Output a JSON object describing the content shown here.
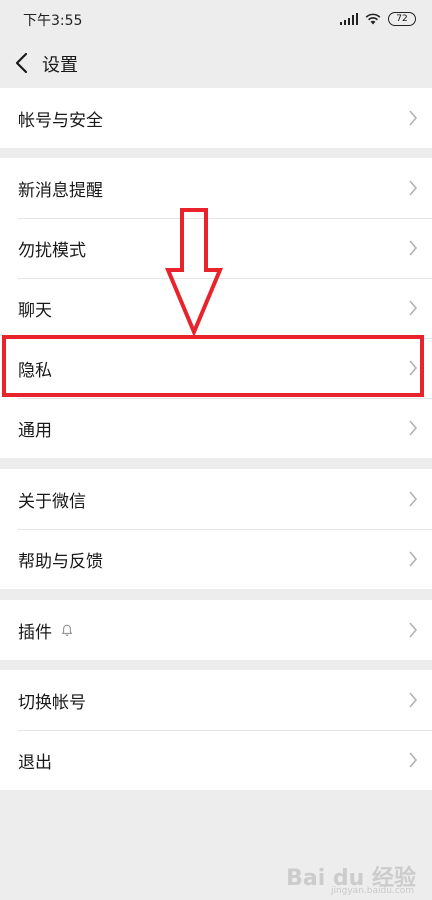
{
  "status_bar": {
    "time": "下午3:55",
    "battery": "72"
  },
  "nav": {
    "title": "设置"
  },
  "groups": [
    {
      "items": [
        {
          "label": "帐号与安全"
        }
      ]
    },
    {
      "items": [
        {
          "label": "新消息提醒"
        },
        {
          "label": "勿扰模式"
        },
        {
          "label": "聊天"
        },
        {
          "label": "隐私"
        },
        {
          "label": "通用"
        }
      ]
    },
    {
      "items": [
        {
          "label": "关于微信"
        },
        {
          "label": "帮助与反馈"
        }
      ]
    },
    {
      "items": [
        {
          "label": "插件"
        }
      ]
    },
    {
      "items": [
        {
          "label": "切换帐号"
        },
        {
          "label": "退出"
        }
      ]
    }
  ],
  "annotation": {
    "highlight_color": "#e8232b",
    "highlighted_item": "隐私"
  },
  "watermark": {
    "text": "Bai du 经验",
    "subtext": "jingyan.baidu.com"
  },
  "colors": {
    "background": "#ededed",
    "row_bg": "#ffffff",
    "divider": "#e5e5e5",
    "chevron": "#b2b2b2"
  }
}
